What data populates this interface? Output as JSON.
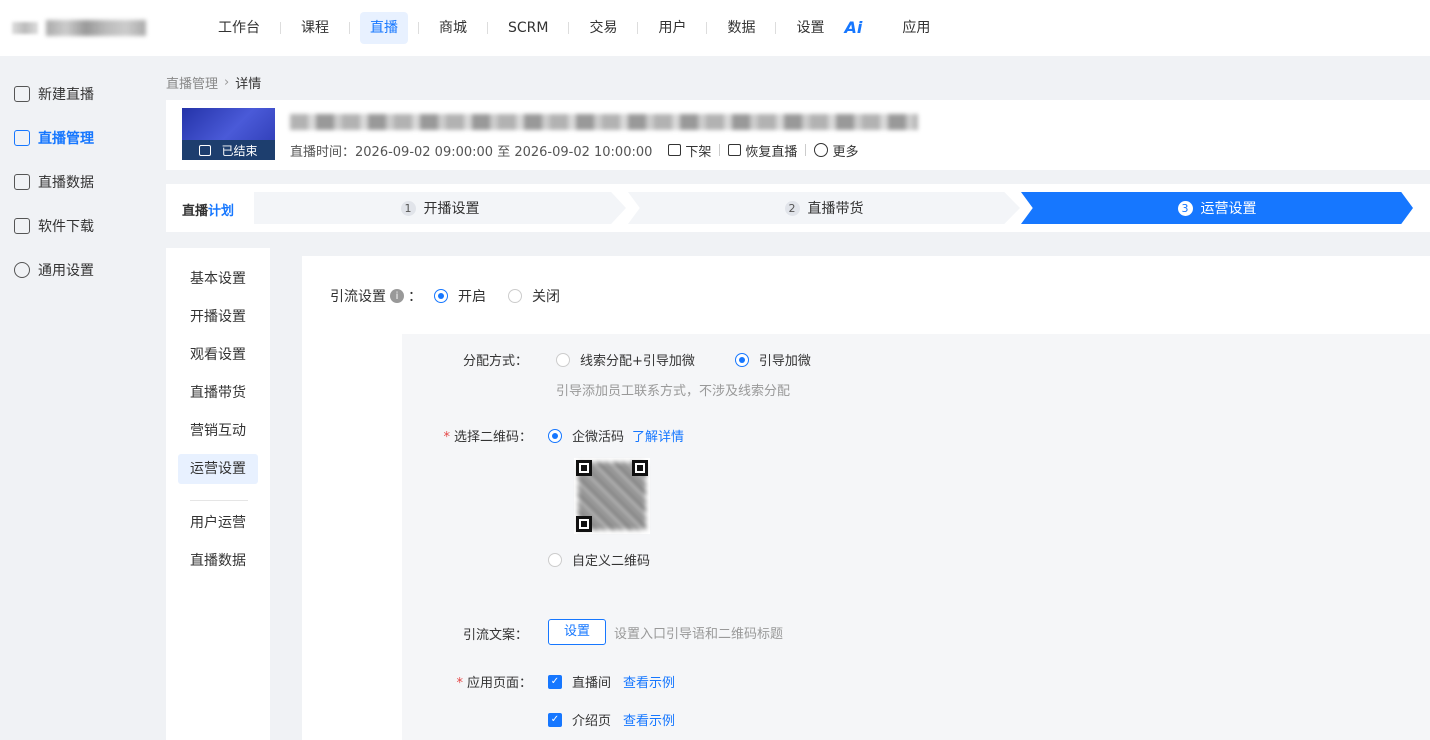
{
  "nav": {
    "items": [
      "工作台",
      "课程",
      "直播",
      "商城",
      "SCRM",
      "交易",
      "用户",
      "数据",
      "设置",
      "Ai",
      "应用"
    ]
  },
  "sidebar": {
    "items": [
      {
        "label": "新建直播",
        "icon": "video-add-icon"
      },
      {
        "label": "直播管理",
        "icon": "live-manage-icon"
      },
      {
        "label": "直播数据",
        "icon": "bar-chart-icon"
      },
      {
        "label": "软件下载",
        "icon": "download-icon"
      },
      {
        "label": "通用设置",
        "icon": "gear-icon"
      }
    ]
  },
  "breadcrumb": {
    "parent": "直播管理",
    "current": "详情"
  },
  "header": {
    "status": "已结束",
    "time": "直播时间：2026-09-02 09:00:00 至 2026-09-02 10:00:00",
    "actions": [
      "下架",
      "恢复直播",
      "更多"
    ]
  },
  "steps": {
    "plan_prefix": "直播",
    "plan_suffix": "计划",
    "items": [
      {
        "num": "1",
        "label": "开播设置"
      },
      {
        "num": "2",
        "label": "直播带货"
      },
      {
        "num": "3",
        "label": "运营设置"
      }
    ]
  },
  "submenu": {
    "items": [
      "基本设置",
      "开播设置",
      "观看设置",
      "直播带货",
      "营销互动",
      "运营设置",
      "用户运营",
      "直播数据"
    ]
  },
  "form": {
    "lead_label": "引流设置",
    "lead_colon": "：",
    "lead_on": "开启",
    "lead_off": "关闭",
    "assign_label": "分配方式：",
    "assign_opt1": "线索分配+引导加微",
    "assign_opt2": "引导加微",
    "assign_hint": "引导添加员工联系方式，不涉及线索分配",
    "qr_label": "选择二维码：",
    "qr_opt1": "企微活码",
    "qr_link": "了解详情",
    "qr_opt2": "自定义二维码",
    "copy_label": "引流文案：",
    "copy_button": "设置",
    "copy_hint": "设置入口引导语和二维码标题",
    "page_label": "应用页面：",
    "page_opt1": "直播间",
    "page_opt2": "介绍页",
    "example_link": "查看示例"
  },
  "colors": {
    "accent": "#1677ff",
    "required": "#e54545"
  }
}
